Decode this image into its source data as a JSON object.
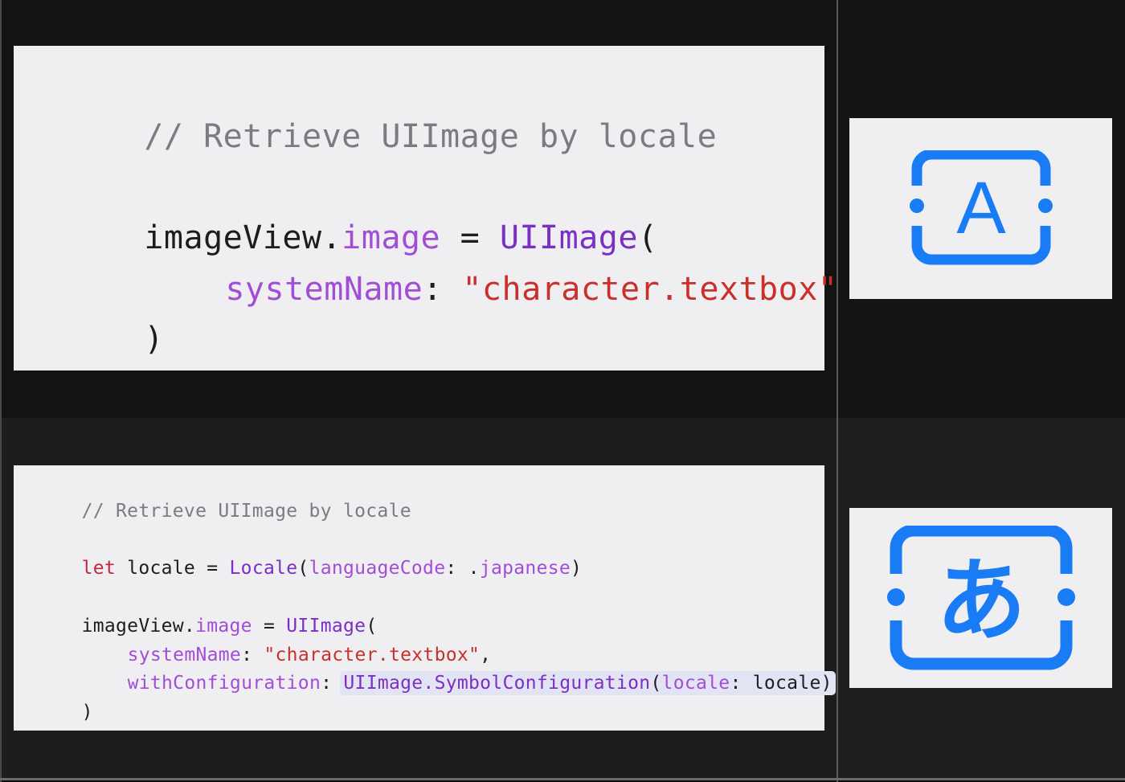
{
  "slide_top": {
    "code": {
      "comment": "// Retrieve UIImage by locale",
      "line1_receiver": "imageView.",
      "line1_prop": "image",
      "line1_eq": " = ",
      "line1_type": "UIImage",
      "line1_paren": "(",
      "line2_param": "systemName",
      "line2_colon": ": ",
      "line2_string": "\"character.textbox\"",
      "line3_close": ")"
    },
    "icon": {
      "name": "character-textbox-icon",
      "glyph": "A",
      "color": "#1a7cf5"
    }
  },
  "slide_bottom": {
    "code": {
      "comment": "// Retrieve UIImage by locale",
      "let_keyword": "let",
      "let_name": " locale = ",
      "let_type": "Locale",
      "let_open": "(",
      "let_param": "languageCode",
      "let_colon": ": .",
      "let_value": "japanese",
      "let_close": ")",
      "line1_receiver": "imageView.",
      "line1_prop": "image",
      "line1_eq": " = ",
      "line1_type": "UIImage",
      "line1_paren": "(",
      "line2_param": "systemName",
      "line2_colon": ": ",
      "line2_string": "\"character.textbox\"",
      "line2_comma": ",",
      "line3_param": "withConfiguration",
      "line3_colon": ": ",
      "line3_type": "UIImage.SymbolConfiguration",
      "line3_open": "(",
      "line3_arg": "locale",
      "line3_argcolon": ": locale)",
      "line4_close": ")"
    },
    "icon": {
      "name": "character-textbox-ja-icon",
      "glyph": "あ",
      "color": "#1a7cf5"
    }
  },
  "colors": {
    "panel_bg": "#efeff1",
    "comment": "#7c7c80",
    "property": "#a24dd6",
    "type": "#7b2fc4",
    "string": "#c9302c",
    "keyword": "#c4283d",
    "icon_blue": "#1a7cf5"
  }
}
